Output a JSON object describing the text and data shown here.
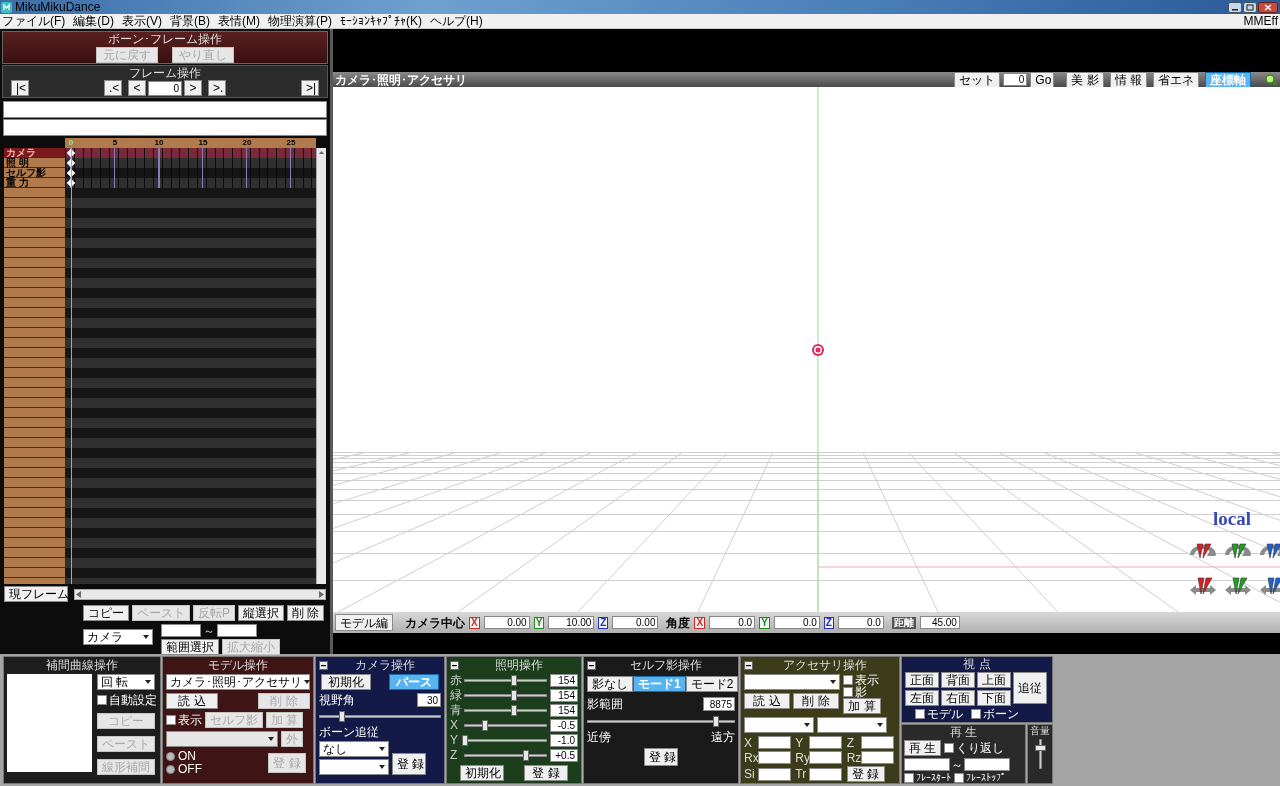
{
  "window": {
    "title": "MikuMikuDance"
  },
  "menu": {
    "items": [
      "ファイル(F)",
      "編集(D)",
      "表示(V)",
      "背景(B)",
      "表情(M)",
      "物理演算(P)",
      "ﾓｰｼｮﾝｷｬﾌﾟﾁｬ(K)",
      "ヘルプ(H)"
    ],
    "right_item": "MMEff"
  },
  "bone_frame_panel": {
    "title": "ボーン･フレーム操作",
    "buttons": [
      {
        "label": "元に戻す",
        "disabled": true
      },
      {
        "label": "やり直し",
        "disabled": true
      }
    ]
  },
  "frame_panel": {
    "title": "フレーム操作",
    "first": "|<",
    "prev_key": ".<",
    "prev": "<",
    "frame": "0",
    "next": ">",
    "next_key": ">.",
    "last": ">|"
  },
  "timeline": {
    "ticks": [
      "0",
      "5",
      "10",
      "15",
      "20",
      "25"
    ],
    "tracks": [
      {
        "label": "カメラ",
        "selected": true,
        "keyframe": true
      },
      {
        "label": "照 明",
        "selected": false,
        "keyframe": true
      },
      {
        "label": "セルフ影",
        "selected": false,
        "keyframe": true
      },
      {
        "label": "重 力",
        "selected": false,
        "keyframe": true
      }
    ]
  },
  "timeline_tools": {
    "current_frame_button": "現フレーム",
    "row1": [
      {
        "label": "コピー",
        "disabled": false
      },
      {
        "label": "ペースト",
        "disabled": true
      },
      {
        "label": "反転P",
        "disabled": true
      },
      {
        "label": "縦選択",
        "disabled": false
      },
      {
        "label": "削 除",
        "disabled": false
      }
    ],
    "target_select": "カメラ",
    "range_separator": "～",
    "row2": [
      {
        "label": "範囲選択",
        "disabled": false
      },
      {
        "label": "拡大縮小",
        "disabled": true
      }
    ]
  },
  "viewport": {
    "title": "カメラ･照明･アクセサリ",
    "set_button": "セット",
    "frame_field": "0",
    "go_button": "Go",
    "toggles": [
      {
        "label": "美 影",
        "selected": false
      },
      {
        "label": "情 報",
        "selected": false
      },
      {
        "label": "省エネ",
        "selected": false
      },
      {
        "label": "座標軸",
        "selected": true
      }
    ],
    "axis_label": "local"
  },
  "status_bar": {
    "model_edit_button": "モデル編",
    "center_label": "カメラ中心",
    "center": [
      {
        "axis": "X",
        "value": "0.00",
        "color": "#d02828"
      },
      {
        "axis": "Y",
        "value": "10.00",
        "color": "#208a20"
      },
      {
        "axis": "Z",
        "value": "0.00",
        "color": "#2830c0"
      }
    ],
    "angle_label": "角度",
    "angle": [
      {
        "axis": "X",
        "value": "0.0",
        "color": "#d02828"
      },
      {
        "axis": "Y",
        "value": "0.0",
        "color": "#208a20"
      },
      {
        "axis": "Z",
        "value": "0.0",
        "color": "#2830c0"
      }
    ],
    "distance_label": "距離",
    "distance": "45.00"
  },
  "interpolation_panel": {
    "title": "補間曲線操作",
    "select": "回 転",
    "auto_setting": {
      "label": "自動設定",
      "checked": false
    },
    "buttons": [
      {
        "label": "コピー",
        "disabled": true
      },
      {
        "label": "ペースト",
        "disabled": true
      },
      {
        "label": "線形補間",
        "disabled": true
      }
    ]
  },
  "model_panel": {
    "title": "モデル操作",
    "select": "カメラ･照明･アクセサリ",
    "buttons": [
      {
        "label": "読 込",
        "disabled": false
      },
      {
        "label": "削 除",
        "disabled": true
      }
    ],
    "show": {
      "label": "表示",
      "checked": false
    },
    "self_shadow_button": {
      "label": "セルフ影",
      "disabled": true
    },
    "add_button": {
      "label": "加 算",
      "disabled": true
    },
    "outside_button": {
      "label": "外",
      "disabled": true
    },
    "radios": [
      {
        "label": "ON",
        "selected": false
      },
      {
        "label": "OFF",
        "selected": false
      }
    ],
    "register_button": {
      "label": "登 録",
      "disabled": true
    }
  },
  "camera_panel": {
    "title": "カメラ操作",
    "buttons": [
      {
        "label": "初期化",
        "selected": false
      },
      {
        "label": "パース",
        "selected": true
      }
    ],
    "fov_label": "視野角",
    "fov": "30",
    "fov_slider": {
      "level": 0.18
    },
    "bone_follow_label": "ボーン追従",
    "bone_select": "なし",
    "register_button": "登 録"
  },
  "lighting_panel": {
    "title": "照明操作",
    "sliders": [
      {
        "label": "赤",
        "value": "154",
        "level": 0.6
      },
      {
        "label": "緑",
        "value": "154",
        "level": 0.6
      },
      {
        "label": "青",
        "value": "154",
        "level": 0.6
      },
      {
        "label": "X",
        "value": "-0.5",
        "level": 0.25
      },
      {
        "label": "Y",
        "value": "-1.0",
        "level": 0
      },
      {
        "label": "Z",
        "value": "+0.5",
        "level": 0.75
      }
    ],
    "buttons": [
      "初期化",
      "登 録"
    ]
  },
  "self_shadow_panel": {
    "title": "セルフ影操作",
    "modes": [
      {
        "label": "影なし",
        "selected": false
      },
      {
        "label": "モード1",
        "selected": true
      },
      {
        "label": "モード2",
        "selected": false
      }
    ],
    "range_label": "影範囲",
    "range": "8875",
    "slider": {
      "level": 0.88
    },
    "near_label": "近傍",
    "far_label": "遠方",
    "register_button": "登 録"
  },
  "accessory_panel": {
    "title": "アクセサリ操作",
    "show": {
      "label": "表示",
      "checked": false
    },
    "shadow": {
      "label": "影",
      "checked": false
    },
    "buttons": [
      {
        "label": "読 込",
        "disabled": false
      },
      {
        "label": "削 除",
        "disabled": false
      },
      {
        "label": "加 算",
        "disabled": false
      }
    ],
    "fields": [
      "X",
      "Y",
      "Z",
      "Rx",
      "Ry",
      "Rz",
      "Si",
      "Tr"
    ],
    "register_button": "登 録"
  },
  "view_panel": {
    "title": "視 点",
    "buttons": [
      "正面",
      "背面",
      "上面",
      "左面",
      "右面",
      "下面"
    ],
    "follow_button": "追従",
    "checks": [
      {
        "label": "モデル",
        "checked": false
      },
      {
        "label": "ボーン",
        "checked": false
      }
    ]
  },
  "play_panel": {
    "title": "再 生",
    "play_button": "再 生",
    "repeat": {
      "label": "くり返し",
      "checked": false
    },
    "range_separator": "～",
    "checks": [
      {
        "label": "ﾌﾚｰｽﾀｰﾄ",
        "checked": false
      },
      {
        "label": "ﾌﾚｰｽﾄｯﾌﾟ",
        "checked": false
      }
    ]
  },
  "volume_panel": {
    "title": "音量",
    "slider": {
      "level": 0.7
    }
  }
}
